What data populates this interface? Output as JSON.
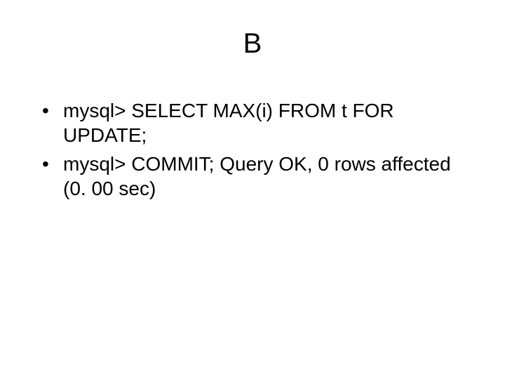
{
  "slide": {
    "title": "B",
    "bullets": [
      "mysql> SELECT MAX(i) FROM t FOR UPDATE;",
      "mysql> COMMIT; Query OK, 0 rows affected (0. 00 sec)"
    ]
  }
}
